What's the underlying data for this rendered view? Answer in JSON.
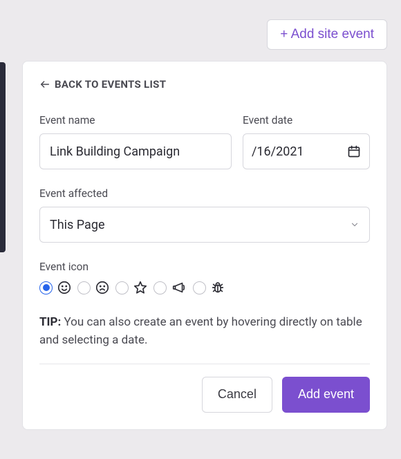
{
  "top_button": {
    "label": "+ Add site event"
  },
  "back": {
    "label": "BACK TO EVENTS LIST"
  },
  "fields": {
    "name": {
      "label": "Event name",
      "value": "Link Building Campaign"
    },
    "date": {
      "label": "Event date",
      "value": "/16/2021"
    },
    "affected": {
      "label": "Event affected",
      "value": "This Page"
    },
    "icon": {
      "label": "Event icon"
    }
  },
  "icons": {
    "options": [
      {
        "name": "happy-face-icon",
        "selected": true
      },
      {
        "name": "sad-face-icon",
        "selected": false
      },
      {
        "name": "star-icon",
        "selected": false
      },
      {
        "name": "megaphone-icon",
        "selected": false
      },
      {
        "name": "bug-icon",
        "selected": false
      }
    ]
  },
  "tip": {
    "label": "TIP:",
    "text": "You can also create an event by hovering directly on table and selecting a date."
  },
  "footer": {
    "cancel": "Cancel",
    "submit": "Add event"
  }
}
